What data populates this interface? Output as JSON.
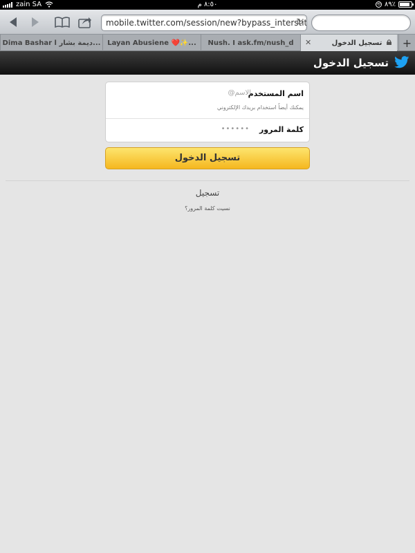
{
  "status_bar": {
    "carrier": "zain SA",
    "time": "٨:٥٠ م",
    "battery": "٨٩٪",
    "battery_level_fraction": 0.89
  },
  "toolbar": {
    "url": "mobile.twitter.com/session/new?bypass_interstitial=",
    "icons": [
      "back-arrow-icon",
      "forward-arrow-icon",
      "bookmarks-icon",
      "share-icon",
      "reload-icon"
    ]
  },
  "tabs": [
    {
      "label": "Dima Bashar ديمة بشار ا..."
    },
    {
      "label": "Layan Abusiene ❤️✨..."
    },
    {
      "label": "Nush. I ask.fm/nush_d"
    },
    {
      "label": "تسجيل الدخول",
      "active": true
    }
  ],
  "new_tab_label": "+",
  "header": {
    "title": "تسجيل الدخول",
    "brand_color": "#1da1f2"
  },
  "form": {
    "username_label": "اسم المستخدم",
    "username_placeholder": "@الاسم",
    "email_hint": "يمكنك أيضاً استخدام بريدك الإلكتروني",
    "password_label": "كلمة المرور",
    "password_mask": "••••••",
    "submit_label": "تسجيل الدخول",
    "button_color": "#f9c93a"
  },
  "links": {
    "signup": "تسجيل",
    "forgot_password": "نسيت كلمة المرور؟"
  }
}
